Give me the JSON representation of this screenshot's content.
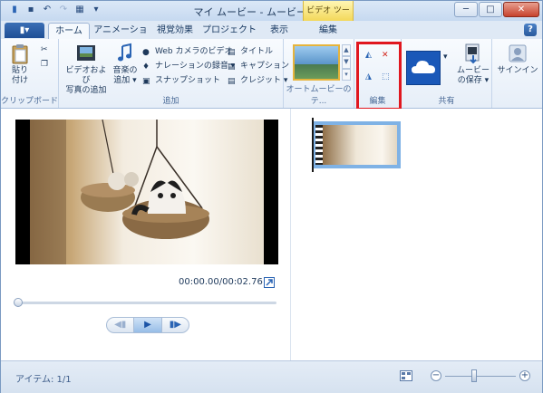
{
  "window": {
    "title": "マイ ムービー - ムービー メーカー",
    "context_tab_header": "ビデオ ツール",
    "quick_access": [
      "save-icon",
      "undo-icon",
      "redo-icon",
      "grid-icon",
      "dropdown-icon"
    ],
    "buttons": {
      "minimize": "─",
      "maximize": "□",
      "close": "✕"
    }
  },
  "tabs": {
    "file": "▮▾",
    "items": [
      {
        "label": "ホーム",
        "active": true
      },
      {
        "label": "アニメーション",
        "active": false
      },
      {
        "label": "視覚効果",
        "active": false
      },
      {
        "label": "プロジェクト",
        "active": false
      },
      {
        "label": "表示",
        "active": false
      },
      {
        "label": "編集",
        "active": false
      }
    ],
    "help": "?"
  },
  "ribbon": {
    "clipboard": {
      "label": "クリップボード",
      "paste": "貼り\n付け"
    },
    "add": {
      "label": "追加",
      "add_videos_photos": "ビデオおよび\n写真の追加",
      "add_music": "音楽の\n追加 ▾",
      "webcam": "Web カメラのビデオ",
      "narration": "ナレーションの録音 ▾",
      "snapshot": "スナップショット",
      "title": "タイトル",
      "caption": "キャプション",
      "credits": "クレジット ▾"
    },
    "automovie": {
      "label": "オートムービーのテ..."
    },
    "editing": {
      "label": "編集"
    },
    "share": {
      "label": "共有",
      "save_movie": "ムービー\nの保存 ▾",
      "sign_in": "サインイン"
    }
  },
  "player": {
    "timecode": "00:00.00/00:02.76",
    "controls": {
      "prev": "◀▮",
      "play": "▶",
      "next": "▮▶"
    },
    "progress": 0.0
  },
  "status": {
    "items": "アイテム: 1/1",
    "zoom_minus": "−",
    "zoom_plus": "+",
    "zoom_level": 0.42
  },
  "colors": {
    "accent": "#1f4f96",
    "highlight_box": "#e0171f",
    "context_tab": "#f3d85a"
  }
}
